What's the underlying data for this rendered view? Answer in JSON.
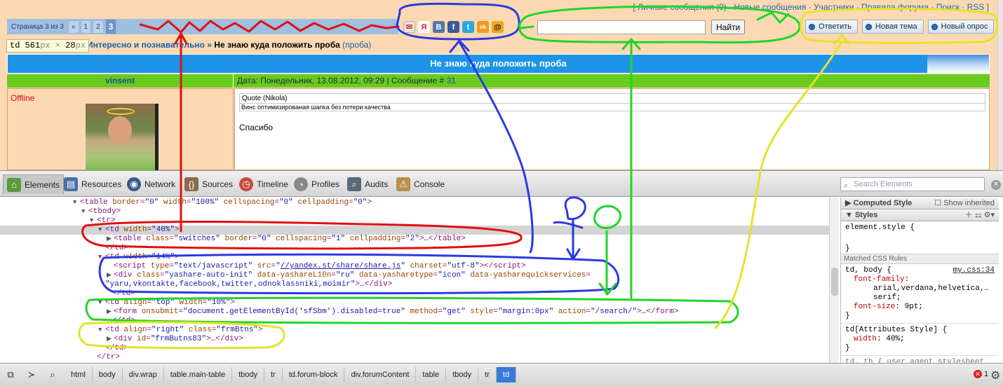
{
  "forum": {
    "top_links": [
      "[ Личные сообщения (0)",
      "Новые сообщения",
      "Участники",
      "Правила форума",
      "Поиск",
      "RSS ]"
    ],
    "pager": {
      "label": "Страница 3 из 3",
      "items": [
        "«",
        "1",
        "2",
        "3"
      ]
    },
    "share_icons": [
      "moimir-icon",
      "yaru-icon",
      "vkontakte-icon",
      "facebook-icon",
      "twitter-icon",
      "odnoklassniki-icon",
      "mailru-icon"
    ],
    "share_letters": [
      "✉",
      "Я",
      "B",
      "f",
      "t",
      "ok",
      "@"
    ],
    "search_button": "Найти",
    "search_value": "",
    "buttons": [
      "Ответить",
      "Новая тема",
      "Новый опрос"
    ],
    "inspect_tooltip": {
      "tag": "td",
      "w": "561",
      "h": "28",
      "unit": "px",
      "times": "×"
    },
    "breadcrumb": {
      "section": "Интересно и познавательно",
      "sep": "»",
      "topic": "Не знаю куда положить проба",
      "sub": "(проба)"
    },
    "thread_title": "Не знаю куда положить проба",
    "post": {
      "author": "vinsent",
      "meta": "Дата: Понедельник, 13.08.2012, 09:29 | Сообщение #",
      "number": "31",
      "status": "Offline",
      "quote_title": "Quote (Nikola)",
      "quote_text": "Винс оптимизированая шапка без потери качества",
      "text": "Спасибо"
    }
  },
  "devtools": {
    "tabs": [
      "Elements",
      "Resources",
      "Network",
      "Sources",
      "Timeline",
      "Profiles",
      "Audits",
      "Console"
    ],
    "search_placeholder": "Search Elements",
    "styles": {
      "computed": "Computed Style",
      "show_inherited": "Show inherited",
      "styles_label": "Styles",
      "element_style": "element.style {",
      "close_brace": "}",
      "matched": "Matched CSS Rules",
      "rule1_selector": "td, body {",
      "rule1_source": "my.css:34",
      "rule1_prop1": "font-family",
      "rule1_val1": "arial,verdana,helvetica,…",
      "rule1_val1b": "serif;",
      "rule1_prop2": "font-size",
      "rule1_val2": "9pt;",
      "rule2_selector": "td[Attributes Style] {",
      "rule2_prop": "width",
      "rule2_val": "40%;",
      "rule3_partial": "td, th {  user agent stylesheet"
    },
    "breadcrumbs": [
      "html",
      "body",
      "div.wrap",
      "table.main-table",
      "tbody",
      "tr",
      "td.forum-block",
      "div.forumContent",
      "table",
      "tbody",
      "tr",
      "td"
    ],
    "error_count": "1",
    "error_badge": "✕"
  }
}
